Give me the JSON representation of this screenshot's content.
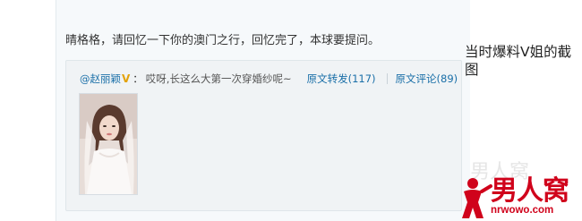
{
  "post": {
    "text": "晴格格，请回忆一下你的澳门之行，回忆完了，本球要提问。"
  },
  "quote": {
    "author": "@赵丽颖",
    "verified_badge": "V",
    "colon": "：",
    "text": "哎呀,长这么大第一次穿婚纱呢~",
    "repost_link": "原文转发(117)",
    "comment_link": "原文评论(89)"
  },
  "caption": "当时爆料V姐的截图",
  "logo": {
    "title": "男人窝",
    "url": "nrwowo.com",
    "watermark": "男人窝"
  },
  "colors": {
    "link": "#1a6fa8",
    "badge": "#e3a30c",
    "logo_red": "#d0021b"
  }
}
